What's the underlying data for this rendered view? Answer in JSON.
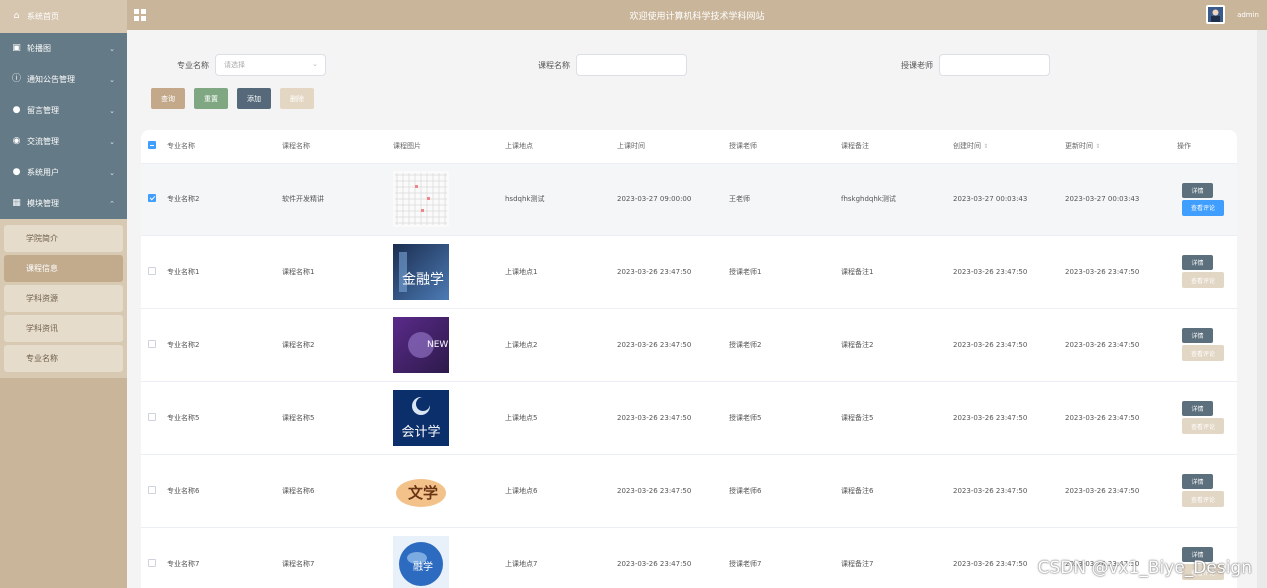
{
  "topbar": {
    "title": "欢迎使用计算机科学技术学科网站",
    "user": "admin"
  },
  "sidebar": {
    "home": "系统首页",
    "menu": [
      {
        "label": "轮播图",
        "icon": "picture-icon"
      },
      {
        "label": "通知公告管理",
        "icon": "info-icon"
      },
      {
        "label": "留言管理",
        "icon": "pin-icon"
      },
      {
        "label": "交流管理",
        "icon": "chat-icon"
      },
      {
        "label": "系统用户",
        "icon": "user-icon"
      },
      {
        "label": "模块管理",
        "icon": "grid-icon"
      }
    ],
    "submenu": [
      "学院简介",
      "课程信息",
      "学科资源",
      "学科资讯",
      "专业名称"
    ]
  },
  "filters": {
    "major_label": "专业名称",
    "major_placeholder": "请选择",
    "course_label": "课程名称",
    "course_placeholder": "",
    "teacher_label": "授课老师",
    "teacher_placeholder": ""
  },
  "actions": {
    "search": "查询",
    "reset": "重置",
    "add": "添加",
    "delete": "删除"
  },
  "colors": {
    "search": "#c3a88a",
    "reset": "#7fa882",
    "add": "#55697a",
    "delete": "#e3d6c2",
    "sidebar": "#647a86",
    "accent": "#409eff"
  },
  "table": {
    "headers": [
      "专业名称",
      "课程名称",
      "课程图片",
      "上课地点",
      "上课时间",
      "授课老师",
      "课程备注",
      "创建时间",
      "更新时间",
      "操作"
    ],
    "detail_label": "详情",
    "review_label": "查看评论",
    "rows": [
      {
        "major": "专业名称2",
        "course": "软件开发精讲",
        "place": "hsdqhk测试",
        "time": "2023-03-27 09:00:00",
        "teacher": "王老师",
        "remark": "fhskghdqhk测试",
        "created": "2023-03-27 00:03:43",
        "updated": "2023-03-27 00:03:43",
        "checked": true,
        "img": "table"
      },
      {
        "major": "专业名称1",
        "course": "课程名称1",
        "place": "上课地点1",
        "time": "2023-03-26 23:47:50",
        "teacher": "授课老师1",
        "remark": "课程备注1",
        "created": "2023-03-26 23:47:50",
        "updated": "2023-03-26 23:47:50",
        "checked": false,
        "img": "finance"
      },
      {
        "major": "专业名称2",
        "course": "课程名称2",
        "place": "上课地点2",
        "time": "2023-03-26 23:47:50",
        "teacher": "授课老师2",
        "remark": "课程备注2",
        "created": "2023-03-26 23:47:50",
        "updated": "2023-03-26 23:47:50",
        "checked": false,
        "img": "news"
      },
      {
        "major": "专业名称5",
        "course": "课程名称5",
        "place": "上课地点5",
        "time": "2023-03-26 23:47:50",
        "teacher": "授课老师5",
        "remark": "课程备注5",
        "created": "2023-03-26 23:47:50",
        "updated": "2023-03-26 23:47:50",
        "checked": false,
        "img": "accounting"
      },
      {
        "major": "专业名称6",
        "course": "课程名称6",
        "place": "上课地点6",
        "time": "2023-03-26 23:47:50",
        "teacher": "授课老师6",
        "remark": "课程备注6",
        "created": "2023-03-26 23:47:50",
        "updated": "2023-03-26 23:47:50",
        "checked": false,
        "img": "literature"
      },
      {
        "major": "专业名称7",
        "course": "课程名称7",
        "place": "上课地点7",
        "time": "2023-03-26 23:47:50",
        "teacher": "授课老师7",
        "remark": "课程备注7",
        "created": "2023-03-26 23:47:50",
        "updated": "2023-03-26 23:47:50",
        "checked": false,
        "img": "globe"
      }
    ],
    "thumb_text": {
      "finance": "金融学",
      "accounting": "会计学",
      "literature": "文学",
      "globe": "融学"
    }
  },
  "watermark": "CSDN @vx1_Biye_Design"
}
